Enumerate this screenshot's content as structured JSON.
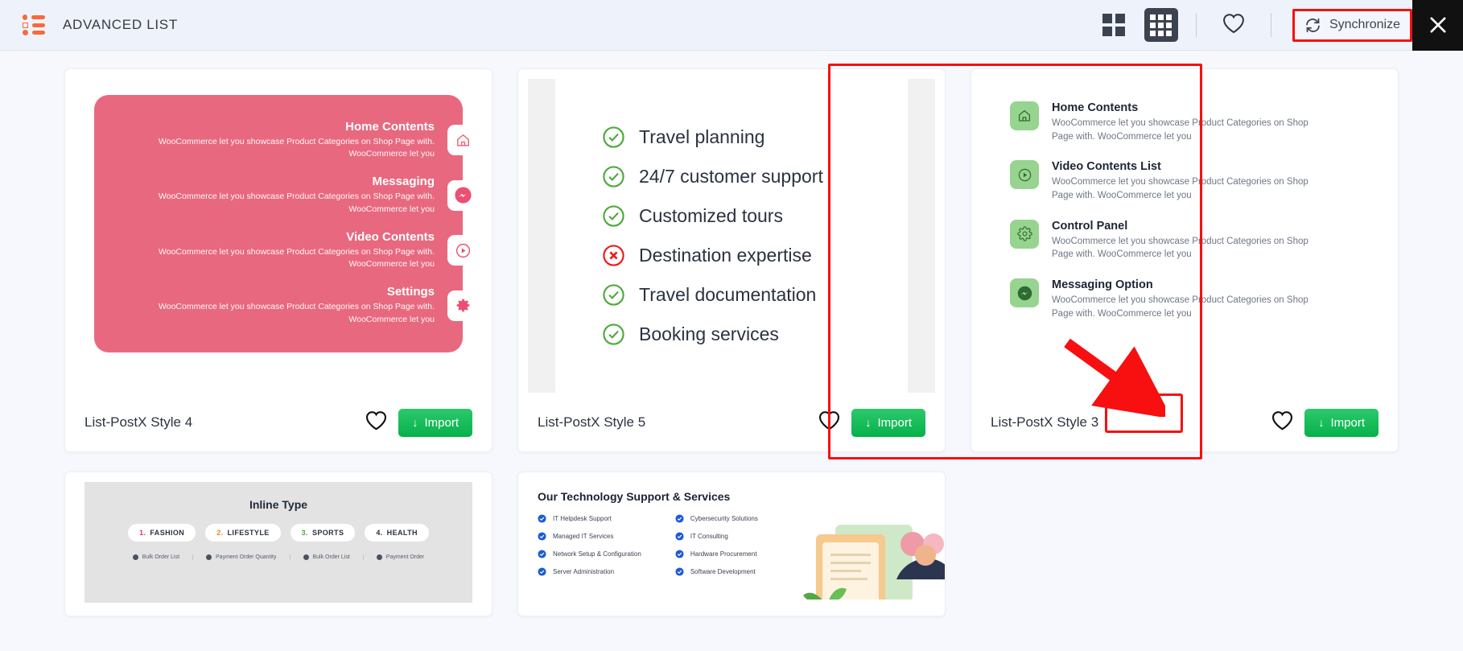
{
  "header": {
    "logo_icon": "list-logo-icon",
    "title": "ADVANCED LIST",
    "grid_view_small": "grid-4-icon",
    "grid_view_large": "grid-9-icon",
    "favorites_icon": "heart-icon",
    "synchronize_label": "Synchronize",
    "synchronize_icon": "sync-refresh-icon",
    "close_icon": "close-x-icon"
  },
  "colors": {
    "accent_orange": "#f8693c",
    "highlight_red": "#f80f0f",
    "import_green": "#06b14a",
    "card1_pink": "#e8697f",
    "card3_icon_green": "#96d48f",
    "check_green": "#4faa3e",
    "cross_red": "#ee1c1c",
    "header_bg": "#eef3fb",
    "page_bg": "#f6f8fd"
  },
  "cards": [
    {
      "name": "List-PostX Style 4",
      "favorite_icon": "heart-icon",
      "import_label": "Import",
      "import_icon": "download-arrow-icon",
      "highlighted": false,
      "style": "pink-right-aligned",
      "items": [
        {
          "title": "Home Contents",
          "desc": "WooCommerce let you showcase Product Categories on Shop Page with. WooCommerce let you",
          "icon": "home-icon"
        },
        {
          "title": "Messaging",
          "desc": "WooCommerce let you showcase Product Categories on Shop Page with. WooCommerce let you",
          "icon": "messenger-icon"
        },
        {
          "title": "Video Contents",
          "desc": "WooCommerce let you showcase Product Categories on Shop Page with. WooCommerce let you",
          "icon": "play-circle-icon"
        },
        {
          "title": "Settings",
          "desc": "WooCommerce let you showcase Product Categories on Shop Page with. WooCommerce let you",
          "icon": "gear-icon"
        }
      ]
    },
    {
      "name": "List-PostX Style 5",
      "favorite_icon": "heart-icon",
      "import_label": "Import",
      "import_icon": "download-arrow-icon",
      "highlighted": false,
      "style": "checklist",
      "items": [
        {
          "label": "Travel planning",
          "status": "check"
        },
        {
          "label": "24/7 customer support",
          "status": "check"
        },
        {
          "label": "Customized tours",
          "status": "check"
        },
        {
          "label": "Destination expertise",
          "status": "cross"
        },
        {
          "label": "Travel documentation",
          "status": "check"
        },
        {
          "label": "Booking services",
          "status": "check"
        }
      ]
    },
    {
      "name": "List-PostX Style 3",
      "favorite_icon": "heart-icon",
      "import_label": "Import",
      "import_icon": "download-arrow-icon",
      "highlighted": true,
      "style": "green-icon-list",
      "items": [
        {
          "title": "Home Contents",
          "desc": "WooCommerce let you showcase Product Categories on Shop Page with. WooCommerce let you",
          "icon": "home-icon"
        },
        {
          "title": "Video Contents List",
          "desc": "WooCommerce let you showcase Product Categories on Shop Page with. WooCommerce let you",
          "icon": "play-circle-icon"
        },
        {
          "title": "Control Panel",
          "desc": "WooCommerce let you showcase Product Categories on Shop Page with. WooCommerce let you",
          "icon": "gear-icon"
        },
        {
          "title": "Messaging Option",
          "desc": "WooCommerce let you showcase Product Categories on Shop Page with. WooCommerce let you",
          "icon": "messenger-icon"
        }
      ]
    }
  ],
  "bottom_cards": [
    {
      "style": "inline-type",
      "title": "Inline Type",
      "pills": [
        {
          "num": "1.",
          "label": "FASHION"
        },
        {
          "num": "2.",
          "label": "LIFESTYLE"
        },
        {
          "num": "3.",
          "label": "SPORTS"
        },
        {
          "num": "4.",
          "label": "HEALTH"
        }
      ],
      "sub_items": [
        "Bulk Order List",
        "Payment Order Quantity",
        "Bulk Order List",
        "Payment Order"
      ]
    },
    {
      "style": "tech-services",
      "title": "Our Technology Support & Services",
      "columns": [
        [
          "IT Helpdesk Support",
          "Managed IT Services",
          "Network Setup & Configuration",
          "Server Administration"
        ],
        [
          "Cybersecurity Solutions",
          "IT Consulting",
          "Hardware Procurement",
          "Software Development"
        ]
      ]
    }
  ]
}
